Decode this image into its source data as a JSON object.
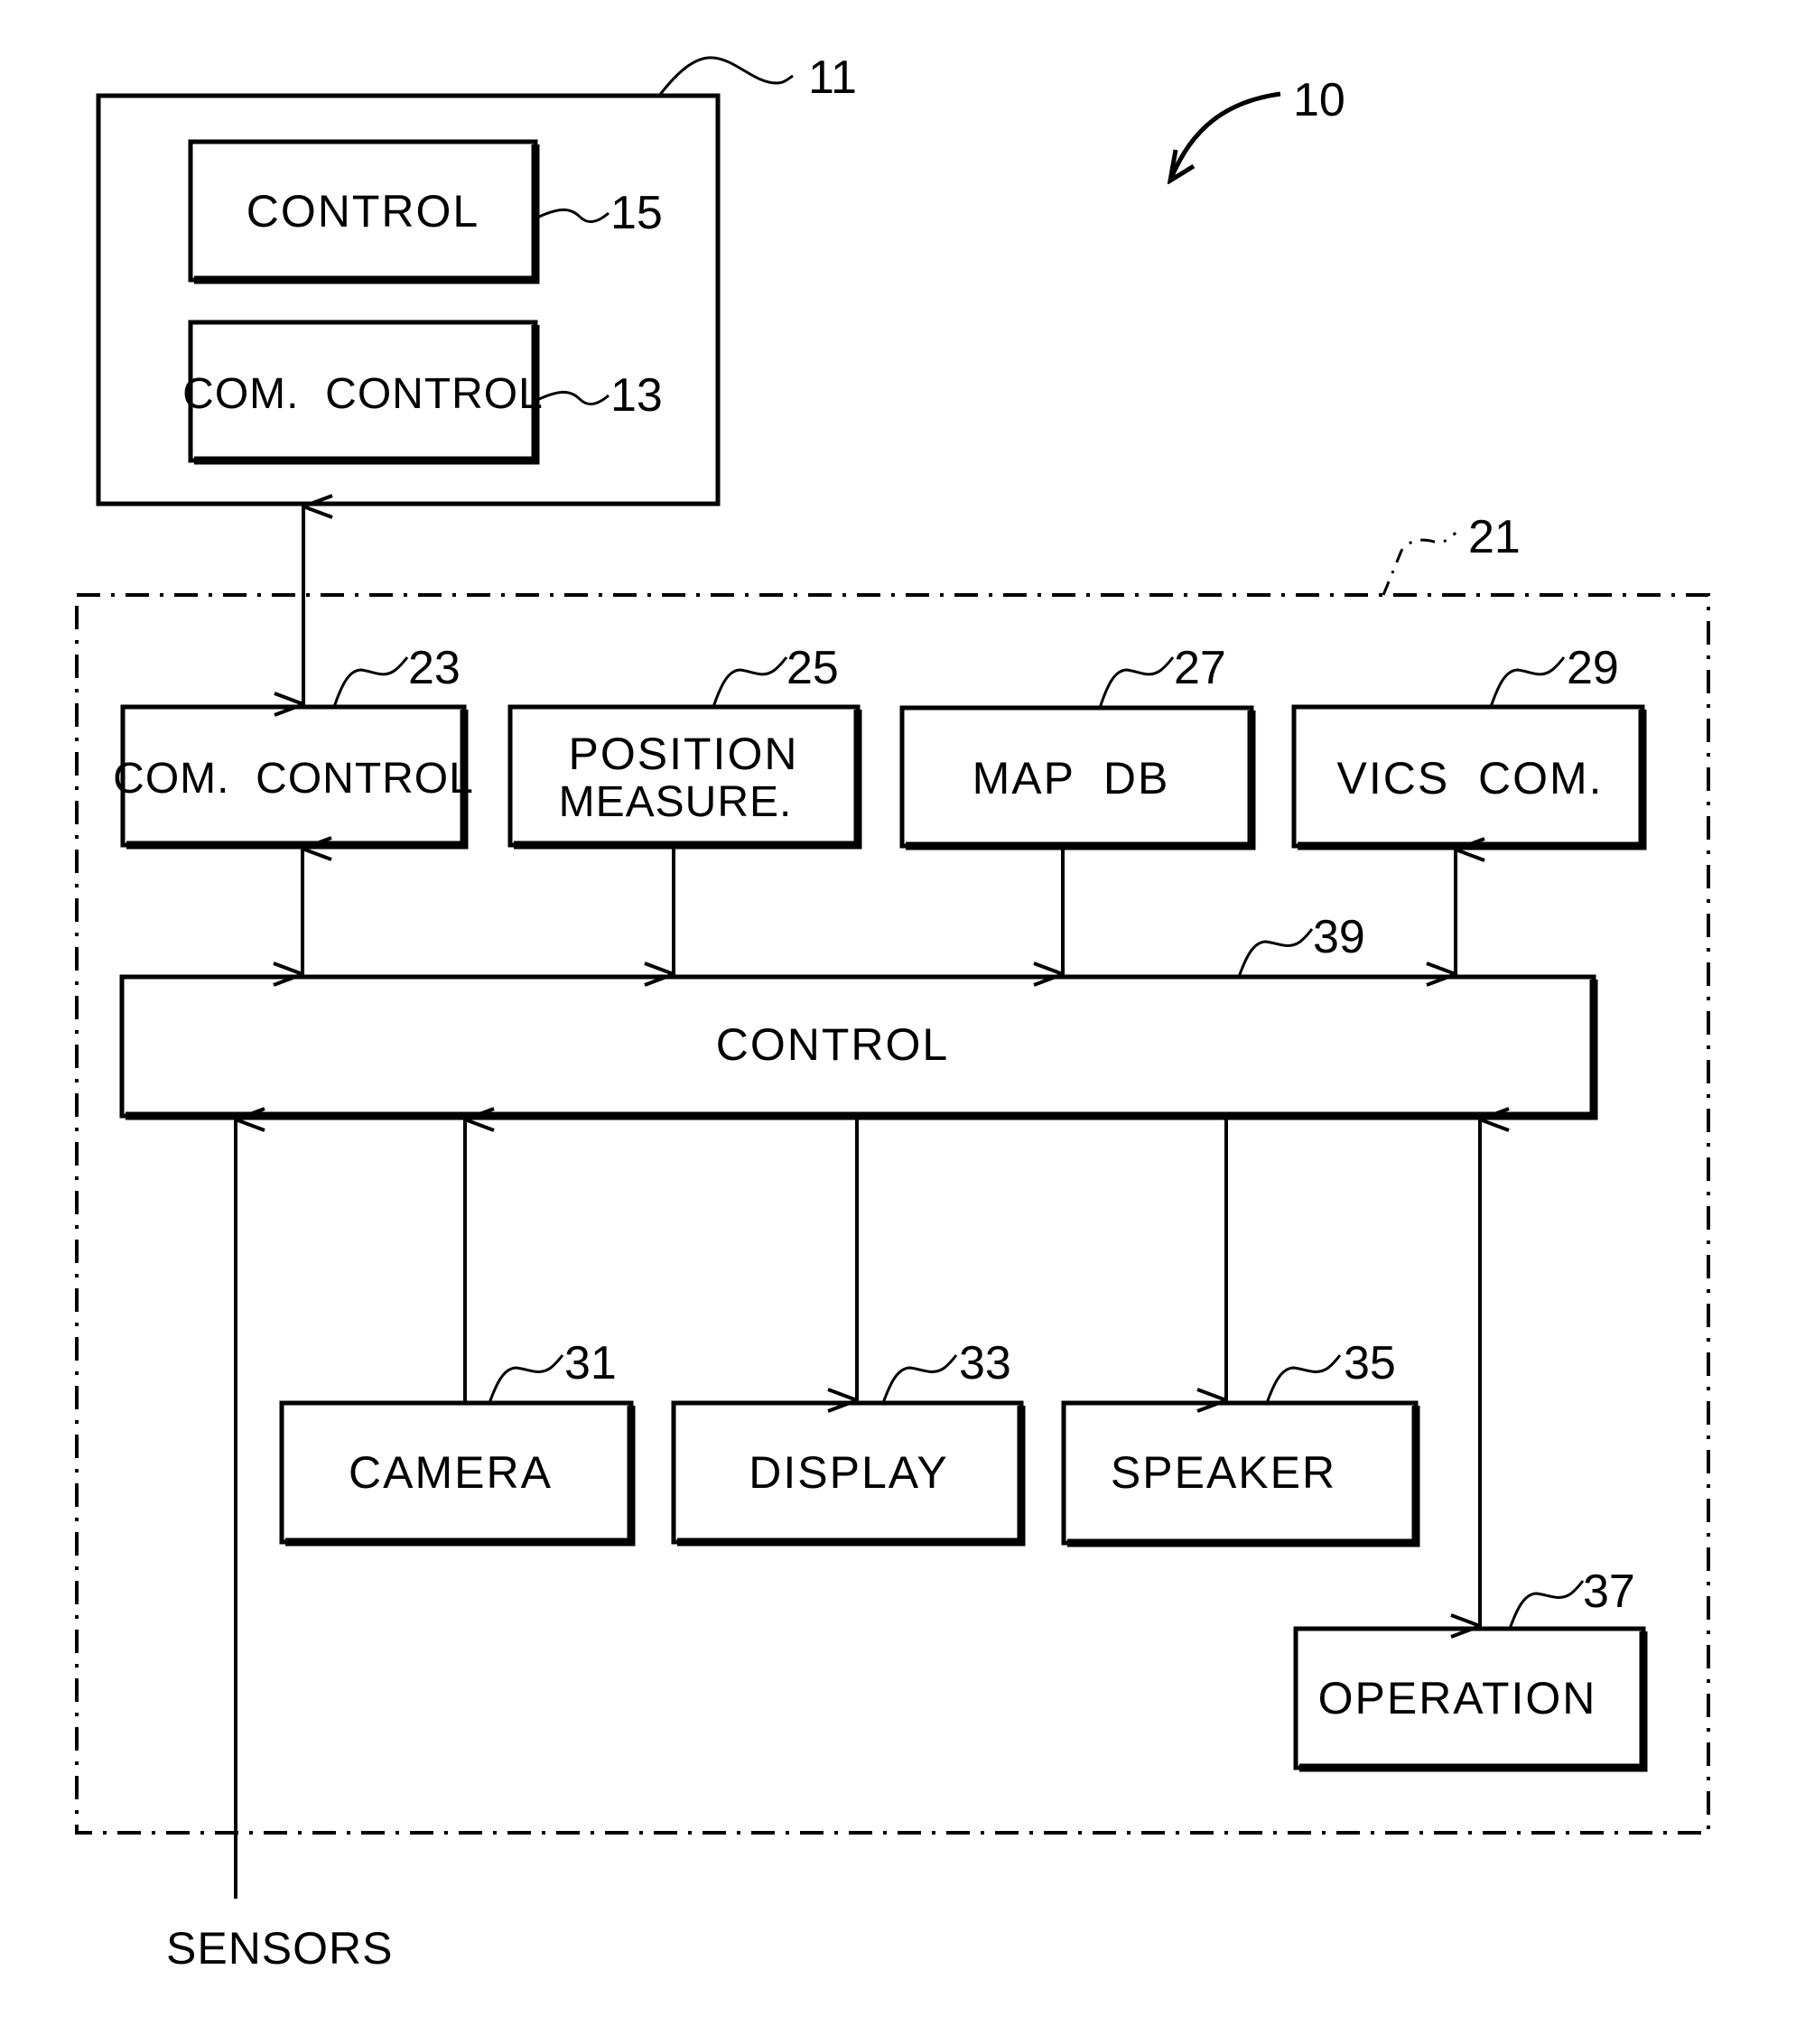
{
  "figure": {
    "system_ref": "10",
    "center_unit": {
      "ref": "11",
      "blocks": [
        {
          "id": "15",
          "label": "CONTROL",
          "ref": "15"
        },
        {
          "id": "13",
          "label": "COM.  CONTROL",
          "ref": "13"
        }
      ]
    },
    "vehicle_unit": {
      "ref": "21",
      "top_row": [
        {
          "id": "23",
          "label_lines": [
            "COM.  CONTROL"
          ],
          "ref": "23"
        },
        {
          "id": "25",
          "label_lines": [
            "POSITION",
            "MEASURE."
          ],
          "ref": "25"
        },
        {
          "id": "27",
          "label_lines": [
            "MAP  DB"
          ],
          "ref": "27"
        },
        {
          "id": "29",
          "label_lines": [
            "VICS  COM."
          ],
          "ref": "29"
        }
      ],
      "control": {
        "id": "39",
        "label": "CONTROL",
        "ref": "39"
      },
      "bottom_row": [
        {
          "id": "31",
          "label": "CAMERA",
          "ref": "31"
        },
        {
          "id": "33",
          "label": "DISPLAY",
          "ref": "33"
        },
        {
          "id": "35",
          "label": "SPEAKER",
          "ref": "35"
        },
        {
          "id": "37",
          "label": "OPERATION",
          "ref": "37"
        }
      ]
    },
    "external_input": {
      "label": "SENSORS"
    },
    "connections": [
      {
        "from": "13",
        "to": "23",
        "direction": "bidirectional"
      },
      {
        "from": "23",
        "to": "39",
        "direction": "bidirectional"
      },
      {
        "from": "25",
        "to": "39",
        "direction": "one-way"
      },
      {
        "from": "27",
        "to": "39",
        "direction": "one-way"
      },
      {
        "from": "29",
        "to": "39",
        "direction": "bidirectional"
      },
      {
        "from": "SENSORS",
        "to": "39",
        "direction": "one-way"
      },
      {
        "from": "31",
        "to": "39",
        "direction": "one-way"
      },
      {
        "from": "39",
        "to": "33",
        "direction": "one-way"
      },
      {
        "from": "39",
        "to": "35",
        "direction": "one-way"
      },
      {
        "from": "39",
        "to": "37",
        "direction": "bidirectional"
      }
    ],
    "colors": {
      "ink": "#000000",
      "paper": "#ffffff"
    }
  }
}
